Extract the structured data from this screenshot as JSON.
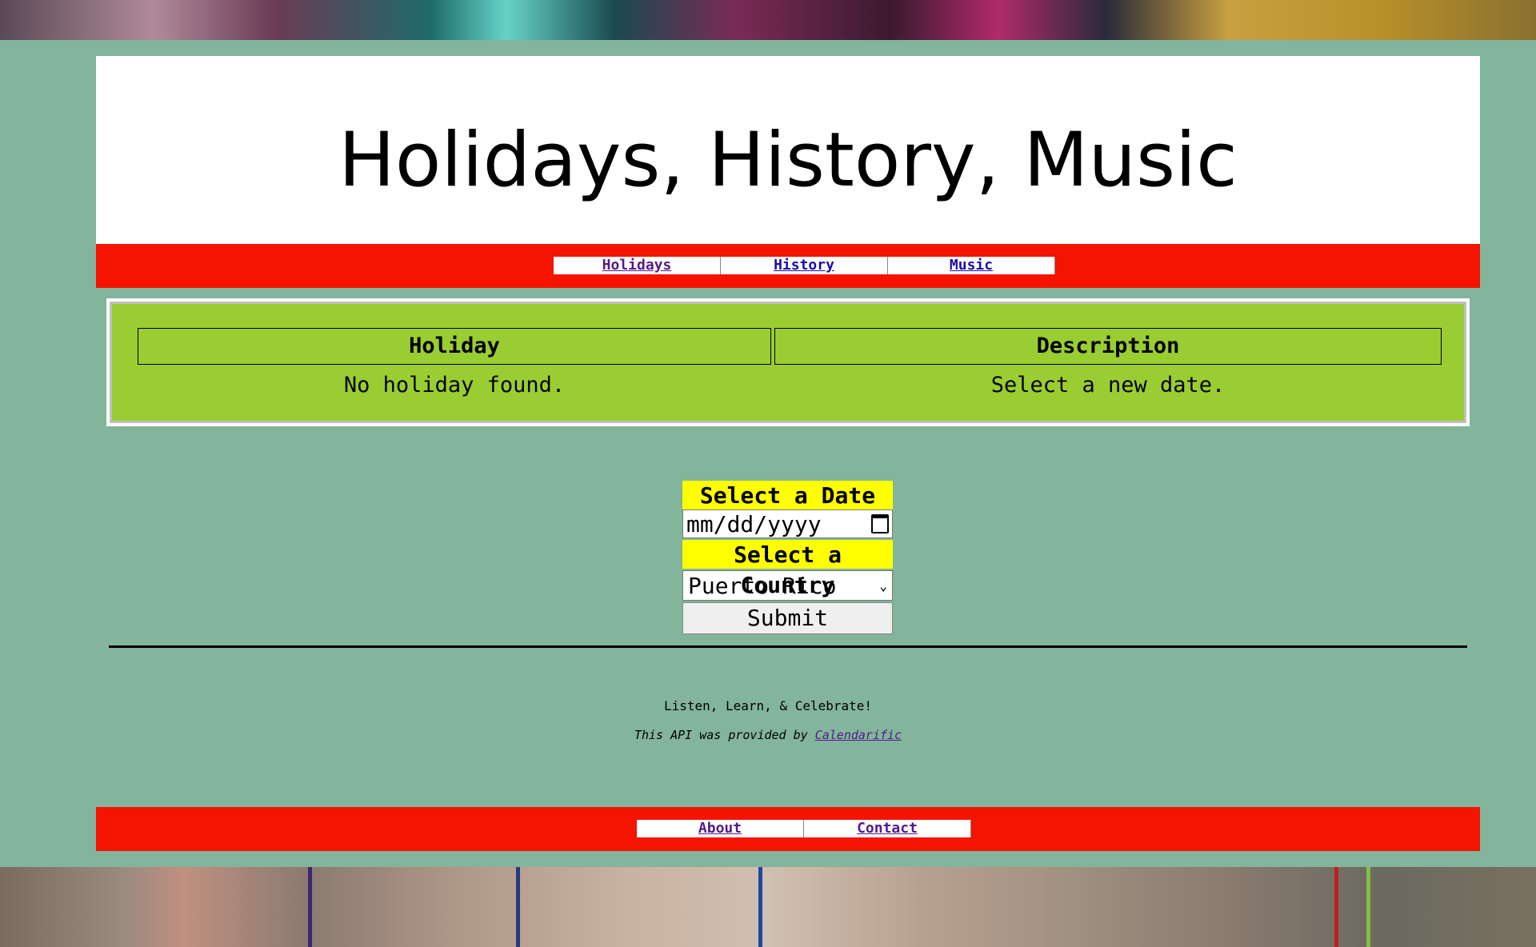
{
  "header": {
    "title": "Holidays, History, Music"
  },
  "top_nav": {
    "items": [
      "Holidays",
      "History",
      "Music"
    ]
  },
  "table": {
    "headers": [
      "Holiday",
      "Description"
    ],
    "rows": [
      [
        "No holiday found.",
        "Select a new date."
      ]
    ]
  },
  "form": {
    "date_label": "Select a Date",
    "date_placeholder": "mm/dd/yyyy",
    "country_label": "Select a Country",
    "country_selected": "Puerto Rico",
    "submit_label": "Submit"
  },
  "footer": {
    "tagline": "Listen, Learn, & Celebrate!",
    "api_text": "This API was provided by",
    "api_link": "Calendarific"
  },
  "bottom_nav": {
    "items": [
      "About",
      "Contact"
    ]
  },
  "colors": {
    "nav_bar": "#f41400",
    "table_bg": "#9acd32",
    "label_bg": "#ffff00",
    "page_bg": "#82b59b"
  },
  "icons": {
    "calendar": "calendar-icon",
    "dropdown": "chevron-down-icon"
  }
}
